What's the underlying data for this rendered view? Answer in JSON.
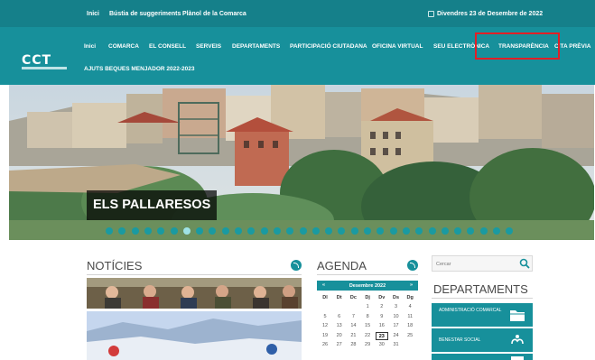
{
  "topbar": {
    "links": [
      "Inici",
      "Bústia de suggeriments",
      "Plànol de la Comarca"
    ],
    "date": "Divendres 23 de Desembre de 2022"
  },
  "nav": {
    "items": [
      "Inici",
      "COMARCA",
      "EL CONSELL",
      "SERVEIS",
      "DEPARTAMENTS",
      "PARTICIPACIÓ CIUTADANA",
      "OFICINA VIRTUAL",
      "SEU ELECTRÒNICA",
      "TRANSPARÈNCIA",
      "CITA PRÈVIA",
      "AJUTS BEQUES MENJADOR 2022-2023"
    ],
    "highlighted": "TRANSPARÈNCIA"
  },
  "logo": {
    "mark": "CCT"
  },
  "hero": {
    "caption": "ELS PALLARESOS",
    "slide_count": 32,
    "active_slide": 6
  },
  "news": {
    "title": "NOTÍCIES",
    "icon": "rss-icon"
  },
  "agenda": {
    "title": "AGENDA",
    "icon": "rss-icon",
    "month": "Desembre 2022",
    "prev": "«",
    "next": "»",
    "weekdays": [
      "Dl",
      "Dt",
      "Dc",
      "Dj",
      "Dv",
      "Ds",
      "Dg"
    ],
    "weeks": [
      [
        "",
        "",
        "",
        "1",
        "2",
        "3",
        "4"
      ],
      [
        "5",
        "6",
        "7",
        "8",
        "9",
        "10",
        "11"
      ],
      [
        "12",
        "13",
        "14",
        "15",
        "16",
        "17",
        "18"
      ],
      [
        "19",
        "20",
        "21",
        "22",
        "23",
        "24",
        "25"
      ],
      [
        "26",
        "27",
        "28",
        "29",
        "30",
        "31",
        ""
      ]
    ],
    "today": "23"
  },
  "search": {
    "placeholder": "Cercar",
    "icon": "search-icon"
  },
  "departments": {
    "title": "DEPARTAMENTS",
    "items": [
      {
        "label": "ADMINISTRACIÓ COMARCAL",
        "icon": "folder-icon"
      },
      {
        "label": "BENESTAR SOCIAL",
        "icon": "hands-icon"
      },
      {
        "label": "",
        "icon": "document-icon"
      }
    ]
  },
  "colors": {
    "topbar": "#15808a",
    "nav": "#17909b",
    "accent": "#17909b",
    "highlight": "#e21f26"
  }
}
